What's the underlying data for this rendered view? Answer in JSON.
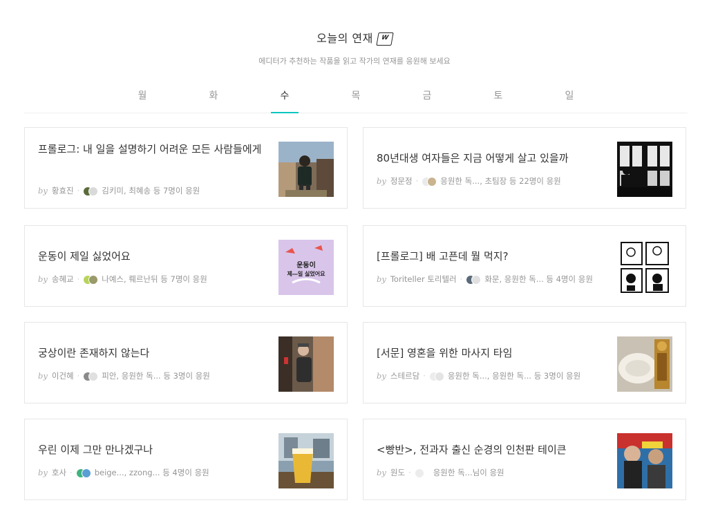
{
  "header": {
    "title": "오늘의 연재",
    "badge": "W",
    "subtitle": "에디터가 추천하는 작품을 읽고 작가의 연재를 응원해 보세요"
  },
  "tabs": [
    {
      "label": "월",
      "active": false
    },
    {
      "label": "화",
      "active": false
    },
    {
      "label": "수",
      "active": true
    },
    {
      "label": "목",
      "active": false
    },
    {
      "label": "금",
      "active": false
    },
    {
      "label": "토",
      "active": false
    },
    {
      "label": "일",
      "active": false
    }
  ],
  "colors": {
    "accent": "#00c6be",
    "muted": "#959595",
    "border": "#e6e6e6"
  },
  "cards": [
    {
      "title": "프롤로그: 내 일을 설명하기 어려운 모든 사람들에게",
      "by": "by",
      "author": "황효진",
      "supporters": "김키미, 최혜송 등 7명이 응원"
    },
    {
      "title": "80년대생 여자들은 지금 어떻게 살고 있을까",
      "by": "by",
      "author": "정문정",
      "supporters": "응원한 독..., 초팀장 등 22명이 응원"
    },
    {
      "title": "운동이 제일 싫었어요",
      "by": "by",
      "author": "송혜교",
      "supporters": "나예스, 뤠르난뒤 등 7명이 응원",
      "cover_text": "운동이\n제―일 싫었어요"
    },
    {
      "title": "[프롤로그] 배 고픈데 뭘 먹지?",
      "by": "by",
      "author": "Toriteller 토리텔러",
      "supporters": "화문, 응원한 독... 등 4명이 응원"
    },
    {
      "title": "궁상이란 존재하지 않는다",
      "by": "by",
      "author": "이건혜",
      "supporters": "피안, 응원한 독... 등 3명이 응원"
    },
    {
      "title": "[서문] 영혼을 위한 마사지 타임",
      "by": "by",
      "author": "스테르담",
      "supporters": "응원한 독..., 응원한 독... 등 3명이 응원"
    },
    {
      "title": "우린 이제 그만 만나겠구나",
      "by": "by",
      "author": "호사",
      "supporters": "beige..., zzong... 등 4명이 응원"
    },
    {
      "title": "<빵반>, 전과자 출신 순경의 인천판 테이큰",
      "by": "by",
      "author": "원도",
      "supporters": "응원한 독...님이 응원"
    }
  ]
}
